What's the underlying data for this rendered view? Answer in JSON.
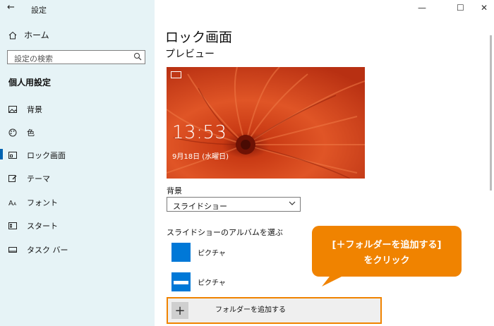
{
  "window": {
    "title": "設定",
    "back_glyph": "←",
    "minimize_glyph": "—",
    "maximize_glyph": "☐",
    "close_glyph": "✕"
  },
  "sidebar": {
    "home_label": "ホーム",
    "search_placeholder": "設定の検索",
    "section_title": "個人用設定",
    "items": [
      {
        "label": "背景",
        "icon": "image-icon"
      },
      {
        "label": "色",
        "icon": "palette-icon"
      },
      {
        "label": "ロック画面",
        "icon": "lock-screen-icon",
        "active": true
      },
      {
        "label": "テーマ",
        "icon": "theme-brush-icon"
      },
      {
        "label": "フォント",
        "icon": "font-icon"
      },
      {
        "label": "スタート",
        "icon": "start-icon"
      },
      {
        "label": "タスク バー",
        "icon": "taskbar-icon"
      }
    ]
  },
  "main": {
    "heading": "ロック画面",
    "preview_label": "プレビュー",
    "preview_time": "13:53",
    "preview_date": "9月18日 (水曜日)",
    "background_label": "背景",
    "background_value": "スライドショー",
    "album_label": "スライドショーのアルバムを選ぶ",
    "albums": [
      {
        "label": "ピクチャ"
      },
      {
        "label": "ピクチャ"
      }
    ],
    "add_folder_label": "フォルダーを追加する"
  },
  "callout": {
    "line1": "[＋フォルダーを追加する]",
    "line2": "をクリック"
  },
  "colors": {
    "accent": "#0078d7",
    "callout": "#f08300",
    "sidebar_bg": "#e6f3f6"
  }
}
